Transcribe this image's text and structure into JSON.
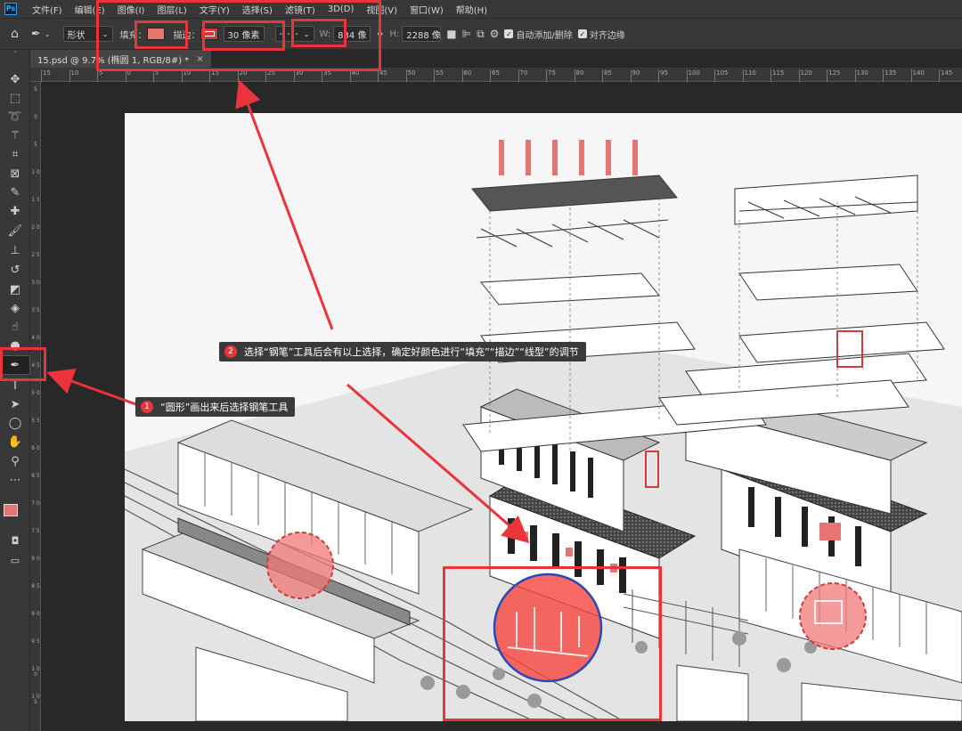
{
  "app": {
    "logo": "Ps"
  },
  "menu": [
    "文件(F)",
    "编辑(E)",
    "图像(I)",
    "图层(L)",
    "文字(Y)",
    "选择(S)",
    "滤镜(T)",
    "3D(D)",
    "视图(V)",
    "窗口(W)",
    "帮助(H)"
  ],
  "options": {
    "mode_value": "形状",
    "fill_label": "填充：",
    "stroke_label": "描边：",
    "stroke_width": "30 像素",
    "width_label": "W:",
    "width_value": "834 像",
    "height_label": "H:",
    "height_value": "2288 像",
    "auto_add_delete": "自动添加/删除",
    "align_edges": "对齐边缘",
    "colors": {
      "fill": "#e47573",
      "stroke": "#d23a3a"
    }
  },
  "tab": {
    "title": "15.psd @ 9.7% (椭圆 1, RGB/8#) *",
    "close": "×"
  },
  "ruler_h": [
    "15",
    "10",
    "5",
    "0",
    "5",
    "10",
    "15",
    "20",
    "25",
    "30",
    "35",
    "40",
    "45",
    "50",
    "55",
    "60",
    "65",
    "70",
    "75",
    "80",
    "85",
    "90",
    "95",
    "100",
    "105",
    "110",
    "115",
    "120",
    "125",
    "130",
    "135",
    "140",
    "145"
  ],
  "ruler_v": [
    "5",
    "0",
    "5",
    "1 0",
    "1 5",
    "2 0",
    "2 5",
    "3 0",
    "3 5",
    "4 0",
    "4 5",
    "5 0",
    "5 5",
    "6 0",
    "6 5",
    "7 0",
    "7 5",
    "8 0",
    "8 5",
    "9 0",
    "9 5",
    "1 0 0",
    "1 0 5"
  ],
  "tools": [
    "move-icon",
    "marquee-icon",
    "lasso-icon",
    "magic-wand-icon",
    "crop-icon",
    "frame-icon",
    "eyedropper-icon",
    "healing-icon",
    "brush-icon",
    "stamp-icon",
    "history-brush-icon",
    "eraser-icon",
    "paint-bucket-icon",
    "smudge-icon",
    "dodge-icon",
    "pen-icon",
    "type-icon",
    "path-select-icon",
    "ellipse-icon",
    "hand-icon",
    "zoom-icon",
    "more-icon"
  ],
  "annotations": {
    "callout1": {
      "num": "1",
      "text": "“圆形”画出来后选择钢笔工具"
    },
    "callout2": {
      "num": "2",
      "text": "选择“钢笔”工具后会有以上选择，确定好颜色进行“填充”“描边”“线型”的调节"
    },
    "accent": "#e8343a"
  }
}
